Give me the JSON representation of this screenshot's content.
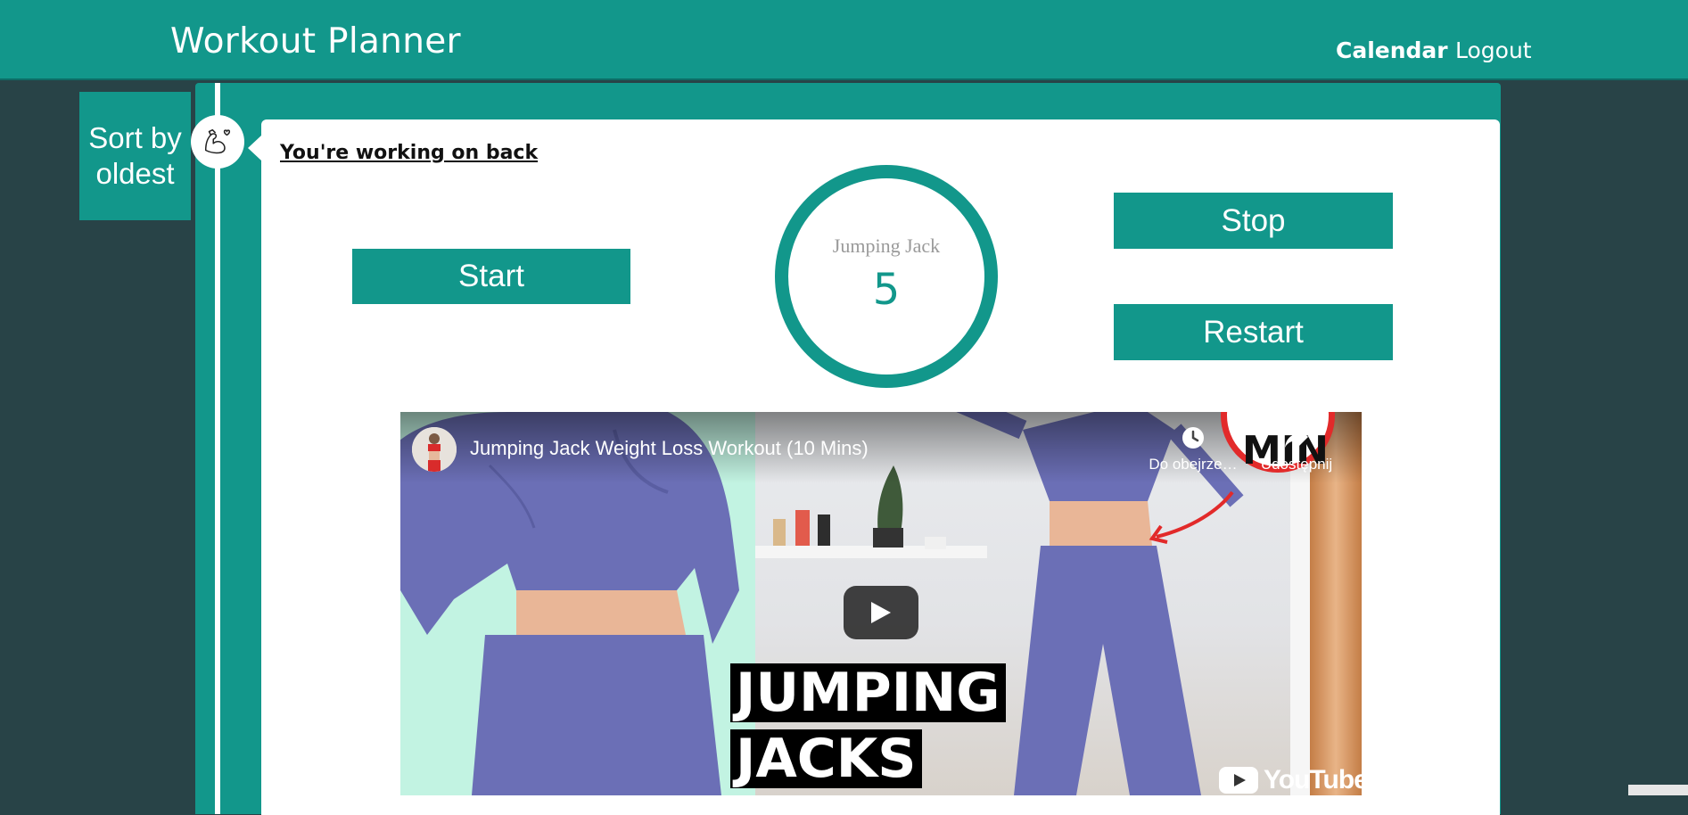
{
  "navbar": {
    "brand": "Workout Planner",
    "links": [
      "Calendar",
      "Logout"
    ]
  },
  "sidebar": {
    "sort_button": "Sort by oldest"
  },
  "workout": {
    "title": "You're working on back",
    "start_label": "Start",
    "stop_label": "Stop",
    "restart_label": "Restart",
    "timer": {
      "exercise": "Jumping Jack",
      "count": "5"
    }
  },
  "video": {
    "title": "Jumping Jack Weight Loss Workout (10 Mins)",
    "watch_later_label": "Do obejrze…",
    "share_label": "Udostępnij",
    "badge_text": "MIN",
    "overlay_lines": [
      "JUMPING",
      "JACKS"
    ],
    "platform": "YouTube"
  },
  "colors": {
    "accent": "#12978b",
    "background": "#284347",
    "card": "#ffffff"
  }
}
